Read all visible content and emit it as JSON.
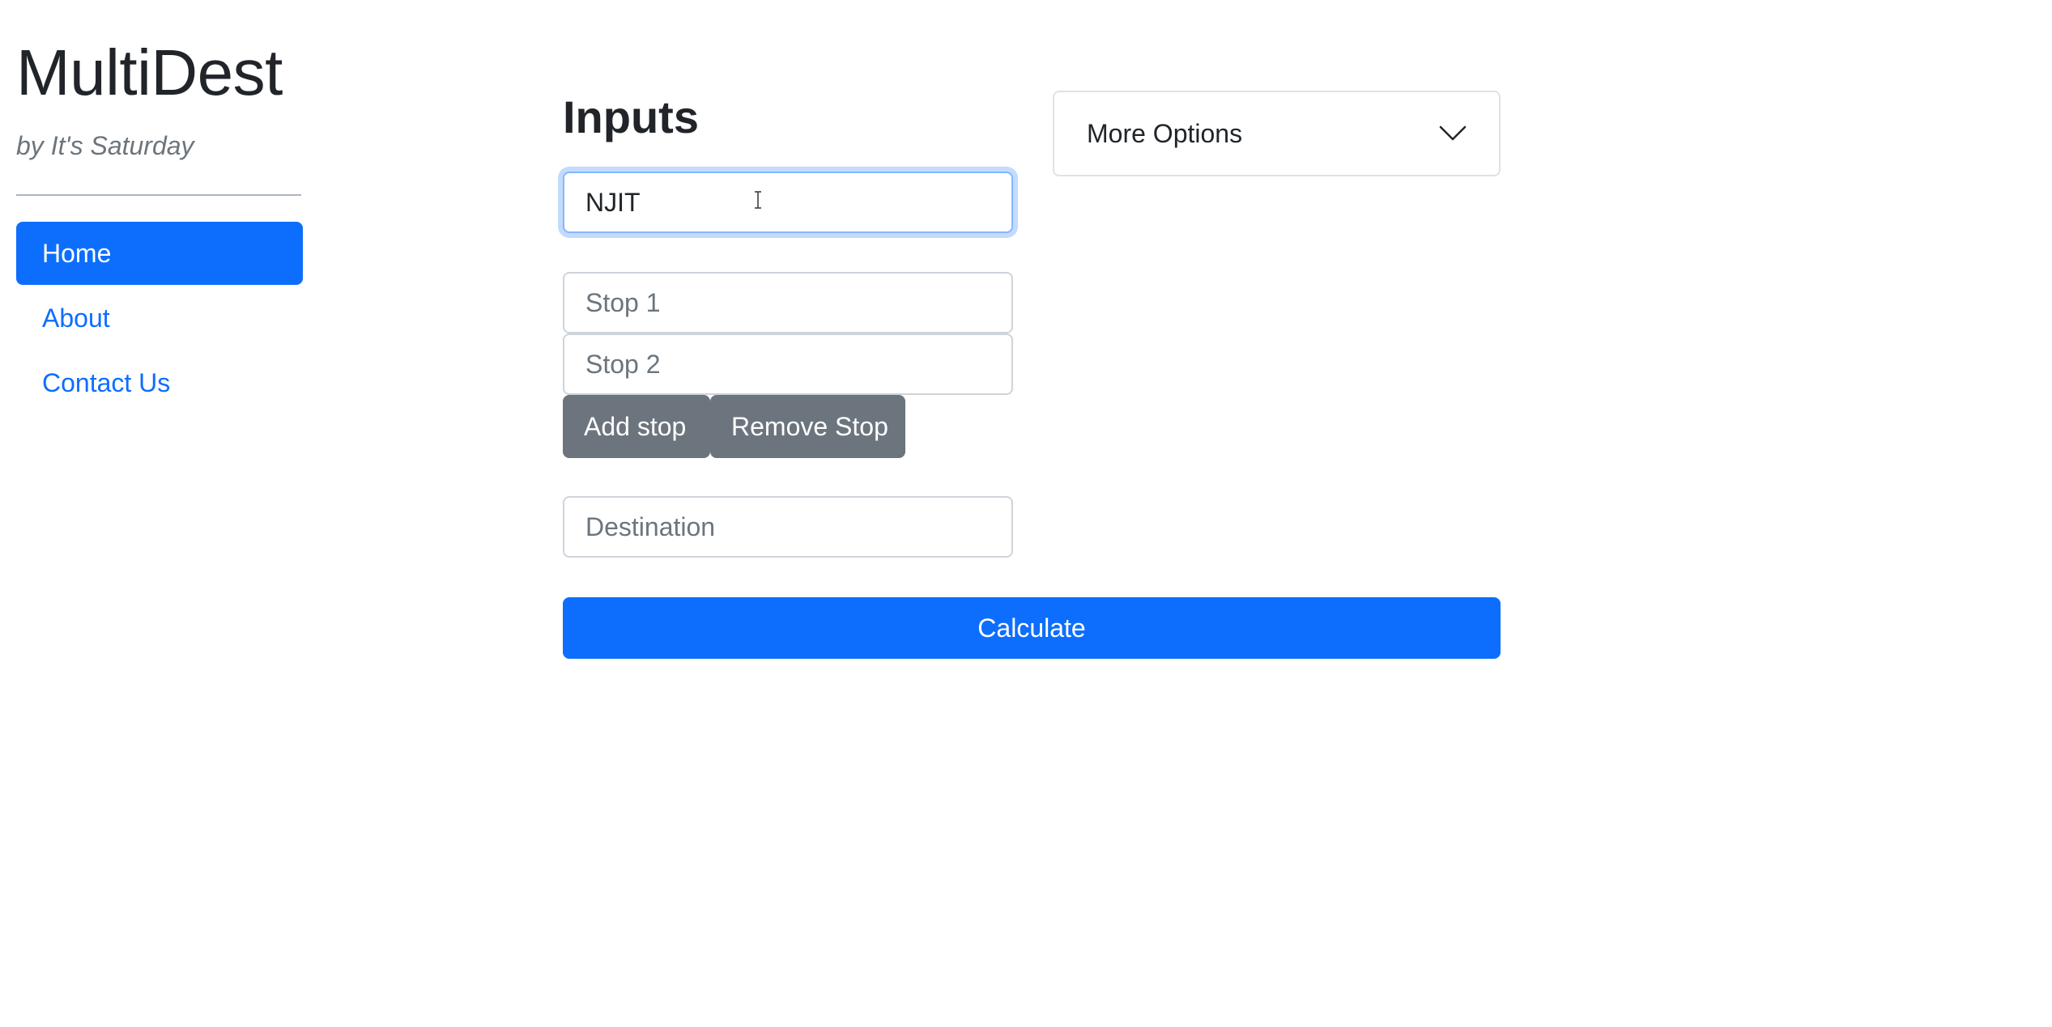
{
  "brand": {
    "title": "MultiDest",
    "tagline": "by It's Saturday"
  },
  "sidebar": {
    "items": [
      {
        "label": "Home",
        "active": true
      },
      {
        "label": "About",
        "active": false
      },
      {
        "label": "Contact Us",
        "active": false
      }
    ]
  },
  "main": {
    "heading": "Inputs",
    "origin": {
      "value": "NJIT",
      "placeholder": ""
    },
    "stops": [
      {
        "value": "",
        "placeholder": "Stop 1"
      },
      {
        "value": "",
        "placeholder": "Stop 2"
      }
    ],
    "add_stop_label": "Add stop",
    "remove_stop_label": "Remove Stop",
    "destination": {
      "value": "",
      "placeholder": "Destination"
    },
    "calculate_label": "Calculate"
  },
  "options": {
    "label": "More Options",
    "icon": "chevron-down-icon"
  },
  "colors": {
    "primary": "#0d6efd",
    "secondary": "#6c757d",
    "muted_text": "#6c757d"
  }
}
